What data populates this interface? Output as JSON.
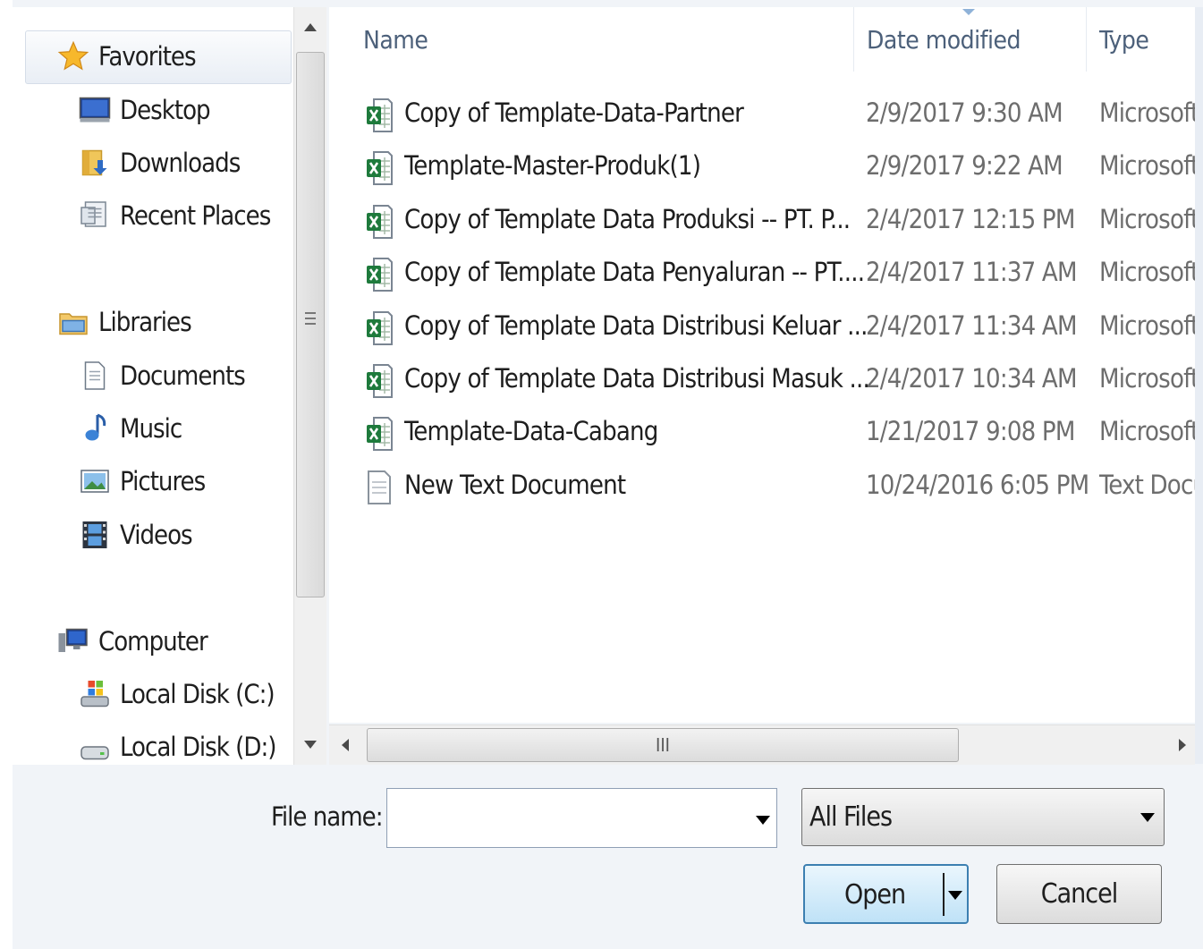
{
  "nav": {
    "favorites": {
      "label": "Favorites",
      "items": [
        "Desktop",
        "Downloads",
        "Recent Places"
      ]
    },
    "libraries": {
      "label": "Libraries",
      "items": [
        "Documents",
        "Music",
        "Pictures",
        "Videos"
      ]
    },
    "computer": {
      "label": "Computer",
      "items": [
        "Local Disk (C:)",
        "Local Disk (D:)"
      ]
    }
  },
  "columns": {
    "name": "Name",
    "date": "Date modified",
    "type": "Type"
  },
  "files": [
    {
      "name": "Copy of Template-Data-Partner",
      "date": "2/9/2017 9:30 AM",
      "type": "Microsoft",
      "icon": "excel-file-icon"
    },
    {
      "name": "Template-Master-Produk(1)",
      "date": "2/9/2017 9:22 AM",
      "type": "Microsoft",
      "icon": "excel-file-icon"
    },
    {
      "name": "Copy of Template Data Produksi -- PT. P...",
      "date": "2/4/2017 12:15 PM",
      "type": "Microsoft",
      "icon": "excel-file-icon"
    },
    {
      "name": "Copy of Template Data Penyaluran -- PT....",
      "date": "2/4/2017 11:37 AM",
      "type": "Microsoft",
      "icon": "excel-file-icon"
    },
    {
      "name": "Copy of Template Data Distribusi Keluar ...",
      "date": "2/4/2017 11:34 AM",
      "type": "Microsoft",
      "icon": "excel-file-icon"
    },
    {
      "name": "Copy of Template Data Distribusi Masuk ...",
      "date": "2/4/2017 10:34 AM",
      "type": "Microsoft",
      "icon": "excel-file-icon"
    },
    {
      "name": "Template-Data-Cabang",
      "date": "1/21/2017 9:08 PM",
      "type": "Microsoft",
      "icon": "excel-file-icon"
    },
    {
      "name": "New Text Document",
      "date": "10/24/2016 6:05 PM",
      "type": "Text Docu",
      "icon": "text-file-icon"
    }
  ],
  "scrollbar": {
    "grip": "III"
  },
  "bottom": {
    "file_name_label": "File name:",
    "file_name_value": "",
    "filter_value": "All Files",
    "open_label": "Open",
    "cancel_label": "Cancel"
  }
}
